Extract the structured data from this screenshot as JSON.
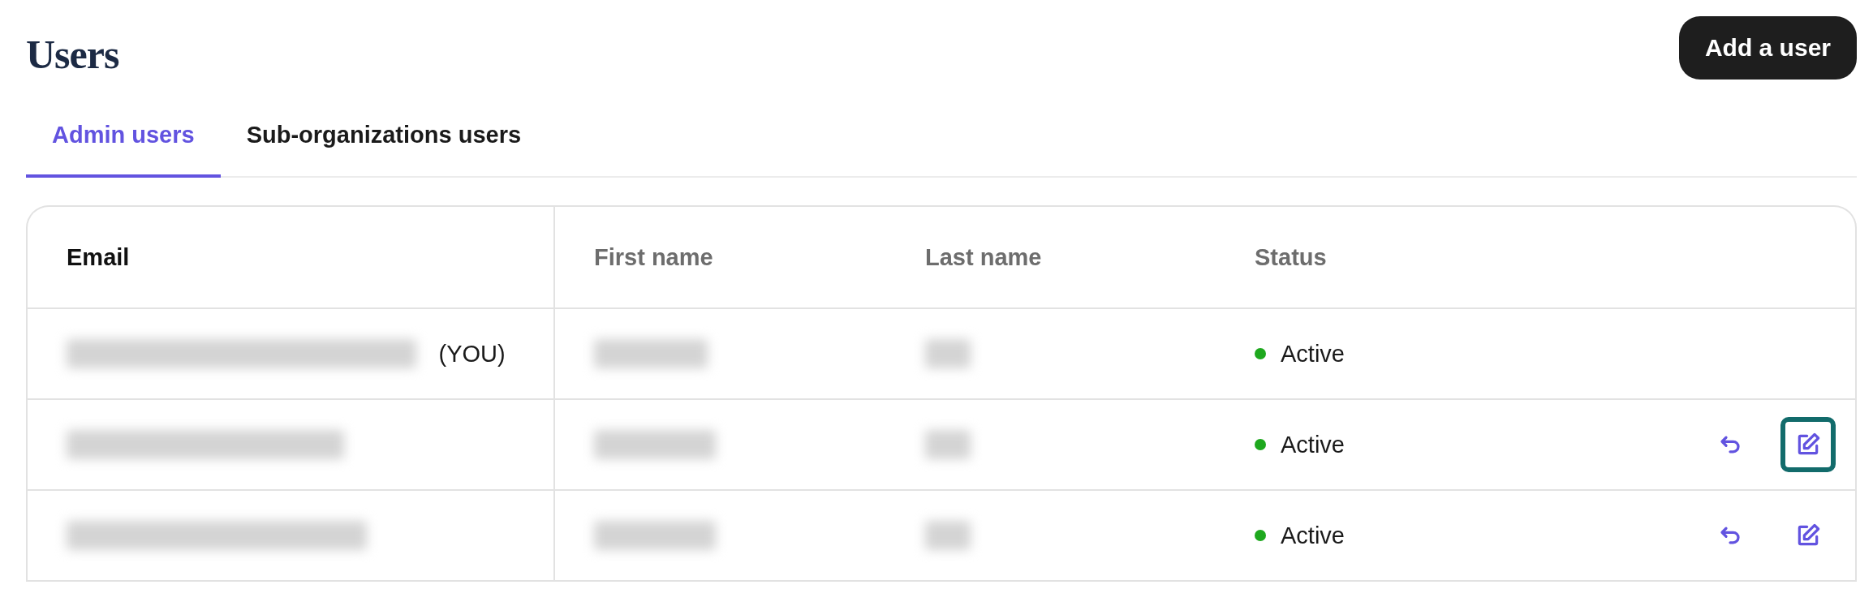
{
  "page": {
    "title": "Users"
  },
  "add_button": {
    "label": "Add a user"
  },
  "tabs": [
    {
      "label": "Admin users",
      "selected": true
    },
    {
      "label": "Sub-organizations users",
      "selected": false
    }
  ],
  "table": {
    "columns": [
      {
        "label": "Email",
        "active": true
      },
      {
        "label": "First name",
        "active": false
      },
      {
        "label": "Last name",
        "active": false
      },
      {
        "label": "Status",
        "active": false
      }
    ],
    "rows": [
      {
        "email": {
          "kind": "redacted"
        },
        "you_badge": "(YOU)",
        "first_name": {
          "kind": "redacted"
        },
        "last_name": {
          "kind": "redacted"
        },
        "status": {
          "label": "Active",
          "color": "#1ea81e"
        },
        "actions": []
      },
      {
        "email": {
          "kind": "redacted"
        },
        "first_name": {
          "kind": "redacted"
        },
        "last_name": {
          "kind": "redacted"
        },
        "status": {
          "label": "Active",
          "color": "#1ea81e"
        },
        "actions": [
          {
            "kind": "undo",
            "focused": false
          },
          {
            "kind": "edit",
            "focused": true
          }
        ]
      },
      {
        "email": {
          "kind": "redacted"
        },
        "first_name": {
          "kind": "redacted"
        },
        "last_name": {
          "kind": "redacted"
        },
        "status": {
          "label": "Active",
          "color": "#1ea81e"
        },
        "actions": [
          {
            "kind": "undo",
            "focused": false
          },
          {
            "kind": "edit",
            "focused": false
          }
        ]
      }
    ]
  }
}
